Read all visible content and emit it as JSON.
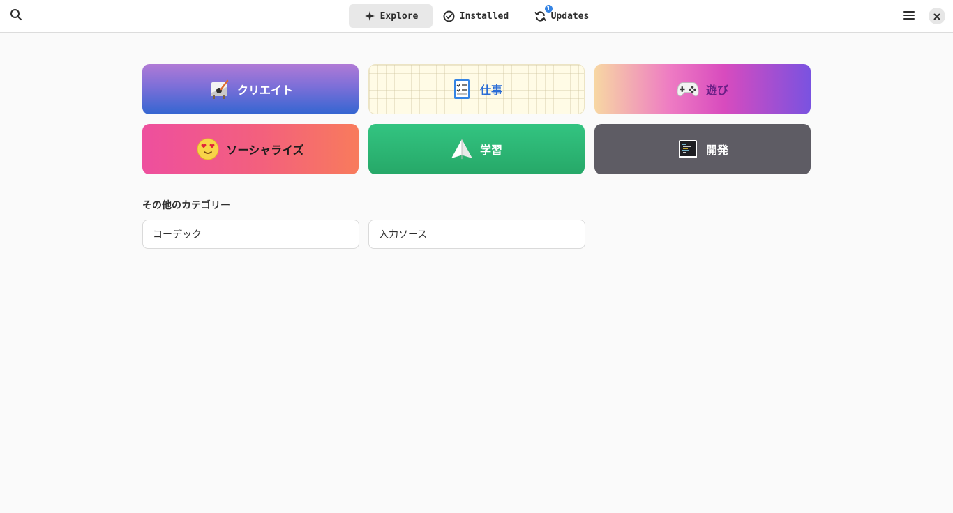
{
  "header": {
    "tabs": [
      {
        "label": "Explore",
        "icon": "explore-sparkle-icon",
        "active": true
      },
      {
        "label": "Installed",
        "icon": "checkmark-circle-icon",
        "active": false
      },
      {
        "label": "Updates",
        "icon": "refresh-icon",
        "active": false,
        "badge": "1"
      }
    ]
  },
  "categories": [
    {
      "label": "クリエイト",
      "icon": "create-easel-icon"
    },
    {
      "label": "仕事",
      "icon": "work-checklist-icon"
    },
    {
      "label": "遊び",
      "icon": "gamepad-icon"
    },
    {
      "label": "ソーシャライズ",
      "icon": "heart-eyes-emoji-icon"
    },
    {
      "label": "学習",
      "icon": "paper-plane-icon"
    },
    {
      "label": "開発",
      "icon": "terminal-code-icon"
    }
  ],
  "other": {
    "title": "その他のカテゴリー",
    "items": [
      {
        "label": "コーデック"
      },
      {
        "label": "入力ソース"
      }
    ]
  },
  "colors": {
    "accent": "#3584e4",
    "background": "#fafafa"
  }
}
